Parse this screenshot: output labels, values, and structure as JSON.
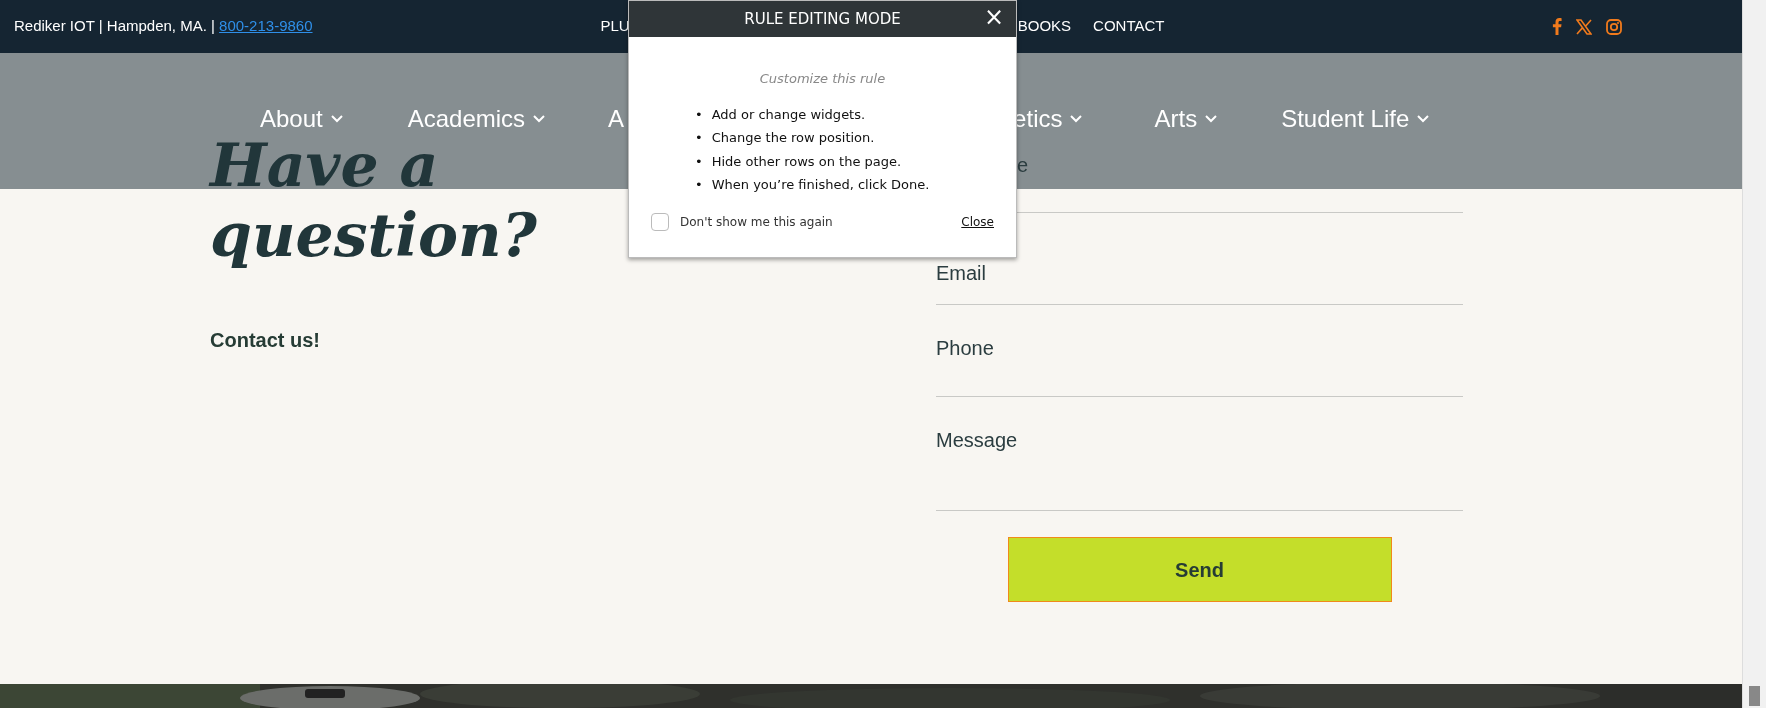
{
  "top_bar": {
    "location": "Rediker IOT | Hampden, MA. |",
    "phone": "800-213-9860",
    "links": [
      {
        "label": "PLU",
        "kind": "first"
      },
      {
        "label": "BOOKS",
        "kind": "mid"
      },
      {
        "label": "CONTACT",
        "kind": "last"
      }
    ],
    "social": [
      {
        "kind": "facebook"
      },
      {
        "kind": "x"
      },
      {
        "kind": "instagram"
      }
    ]
  },
  "nav": [
    {
      "label": "About",
      "caret": true
    },
    {
      "label": "Academics",
      "caret": true
    },
    {
      "label": "A",
      "caret": false
    },
    {
      "label": "etics",
      "caret": true
    },
    {
      "label": "Arts",
      "caret": true
    },
    {
      "label": "Student Life",
      "caret": true
    }
  ],
  "heading": "Have a question?",
  "subheading": "Contact us!",
  "form": {
    "fields": [
      {
        "label": "e",
        "kind": "name"
      },
      {
        "label": "Email",
        "kind": "email"
      },
      {
        "label": "Phone",
        "kind": "phone"
      },
      {
        "label": "Message",
        "kind": "message"
      }
    ],
    "submit": "Send"
  },
  "modal": {
    "title": "RULE EDITING MODE",
    "close_symbol": "×",
    "subtitle": "Customize this rule",
    "bullet": "•",
    "steps": [
      "Add or change widgets.",
      "Change the row position.",
      "Hide other rows on the page.",
      "When you’re finished, click Done."
    ],
    "dont_show": {
      "label": "Don't show me this again",
      "checked": false
    },
    "close_link": "Close"
  }
}
